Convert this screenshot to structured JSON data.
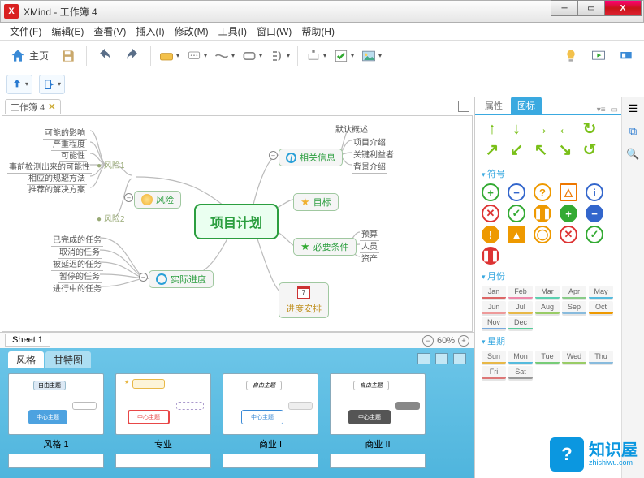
{
  "window": {
    "title": "XMind - 工作簿 4"
  },
  "menu": [
    "文件(F)",
    "编辑(E)",
    "查看(V)",
    "插入(I)",
    "修改(M)",
    "工具(I)",
    "窗口(W)",
    "帮助(H)"
  ],
  "toolbar": {
    "home_label": "主页"
  },
  "tabs": {
    "canvas": "工作簿 4",
    "sheet": "Sheet 1",
    "zoom": "60%"
  },
  "map": {
    "center": "项目计划",
    "info": {
      "label": "相关信息",
      "children": [
        "项目介绍",
        "关键利益者",
        "背景介绍"
      ],
      "extra": "默认概述"
    },
    "goal": {
      "label": "目标"
    },
    "cond": {
      "label": "必要条件",
      "children": [
        "预算",
        "人员",
        "资产"
      ]
    },
    "sched": {
      "label": "进度安排",
      "cal": "7"
    },
    "risk": {
      "label": "风险",
      "r1": "风险1",
      "r2": "风险2",
      "r1_children": [
        "可能的影响",
        "严重程度",
        "可能性",
        "事前检测出来的可能性",
        "相应的规避方法",
        "推荐的解决方案"
      ]
    },
    "prog": {
      "label": "实际进度",
      "children": [
        "已完成的任务",
        "取消的任务",
        "被延迟的任务",
        "暂停的任务",
        "进行中的任务"
      ]
    }
  },
  "band": {
    "tabs": [
      "风格",
      "甘特图"
    ],
    "styles": [
      "风格 1",
      "专业",
      "商业 I",
      "商业 II"
    ],
    "thumb_center": "中心主题"
  },
  "panel": {
    "tabs": [
      "属性",
      "图标"
    ],
    "sec_symbol": "符号",
    "sec_month": "月份",
    "sec_week": "星期",
    "months": [
      "Jan",
      "Feb",
      "Mar",
      "Apr",
      "May",
      "Jun",
      "Jul",
      "Aug",
      "Sep",
      "Oct",
      "Nov",
      "Dec"
    ],
    "month_colors": [
      "#d66",
      "#e8a",
      "#5ad0b0",
      "#8c8",
      "#5bd",
      "#e99",
      "#e8b847",
      "#9c6",
      "#8bd",
      "#e90",
      "#7ad",
      "#5c9"
    ],
    "weeks": [
      "Sun",
      "Mon",
      "Tue",
      "Wed",
      "Thu",
      "Fri",
      "Sat"
    ],
    "week_colors": [
      "#e8b847",
      "#5bd",
      "#7c7",
      "#9c6",
      "#8bd",
      "#d77",
      "#999"
    ]
  },
  "watermark": {
    "big": "知识屋",
    "small": "zhishiwu.com",
    "q": "?"
  }
}
